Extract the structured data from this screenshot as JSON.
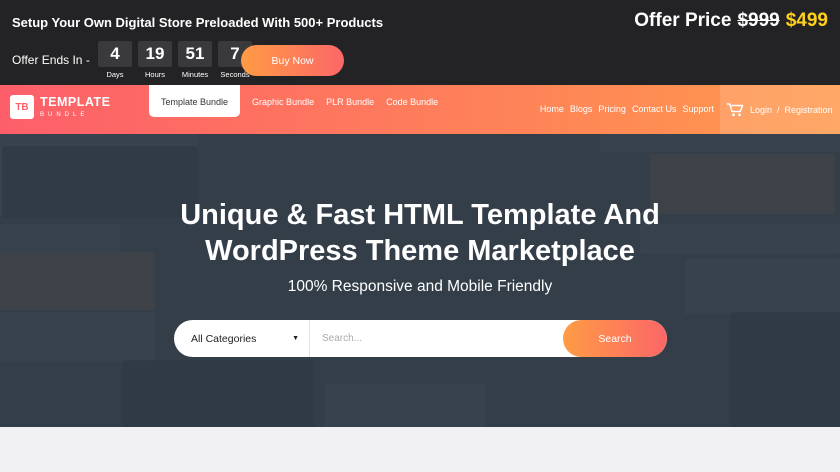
{
  "offer": {
    "headline": "Setup Your Own Digital Store Preloaded With 500+ Products",
    "ends_label": "Offer Ends In -",
    "countdown": [
      {
        "value": "4",
        "label": "Days"
      },
      {
        "value": "19",
        "label": "Hours"
      },
      {
        "value": "51",
        "label": "Minutes"
      },
      {
        "value": "7",
        "label": "Seconds"
      }
    ],
    "buy_label": "Buy Now",
    "price_label": "Offer Price",
    "old_price": "$999",
    "new_price": "$499"
  },
  "nav": {
    "logo_main": "TEMPLATE",
    "logo_sub": "BUNDLE",
    "logo_mark": "TB",
    "tabs": [
      "Template Bundle",
      "Graphic Bundle",
      "PLR Bundle",
      "Code Bundle"
    ],
    "links": [
      "Home",
      "Blogs",
      "Pricing",
      "Contact Us",
      "Support"
    ],
    "login": "Login",
    "separator": "/",
    "register": "Registration"
  },
  "hero": {
    "title_line1": "Unique & Fast HTML Template And",
    "title_line2": "WordPress Theme Marketplace",
    "subtitle": "100% Responsive and Mobile Friendly",
    "category": "All Categories",
    "search_placeholder": "Search...",
    "search_button": "Search"
  },
  "colors": {
    "accent_start": "#fd5f6a",
    "accent_end": "#ff9a4d",
    "price_highlight": "#ffd11a",
    "top_bar": "#232325"
  }
}
